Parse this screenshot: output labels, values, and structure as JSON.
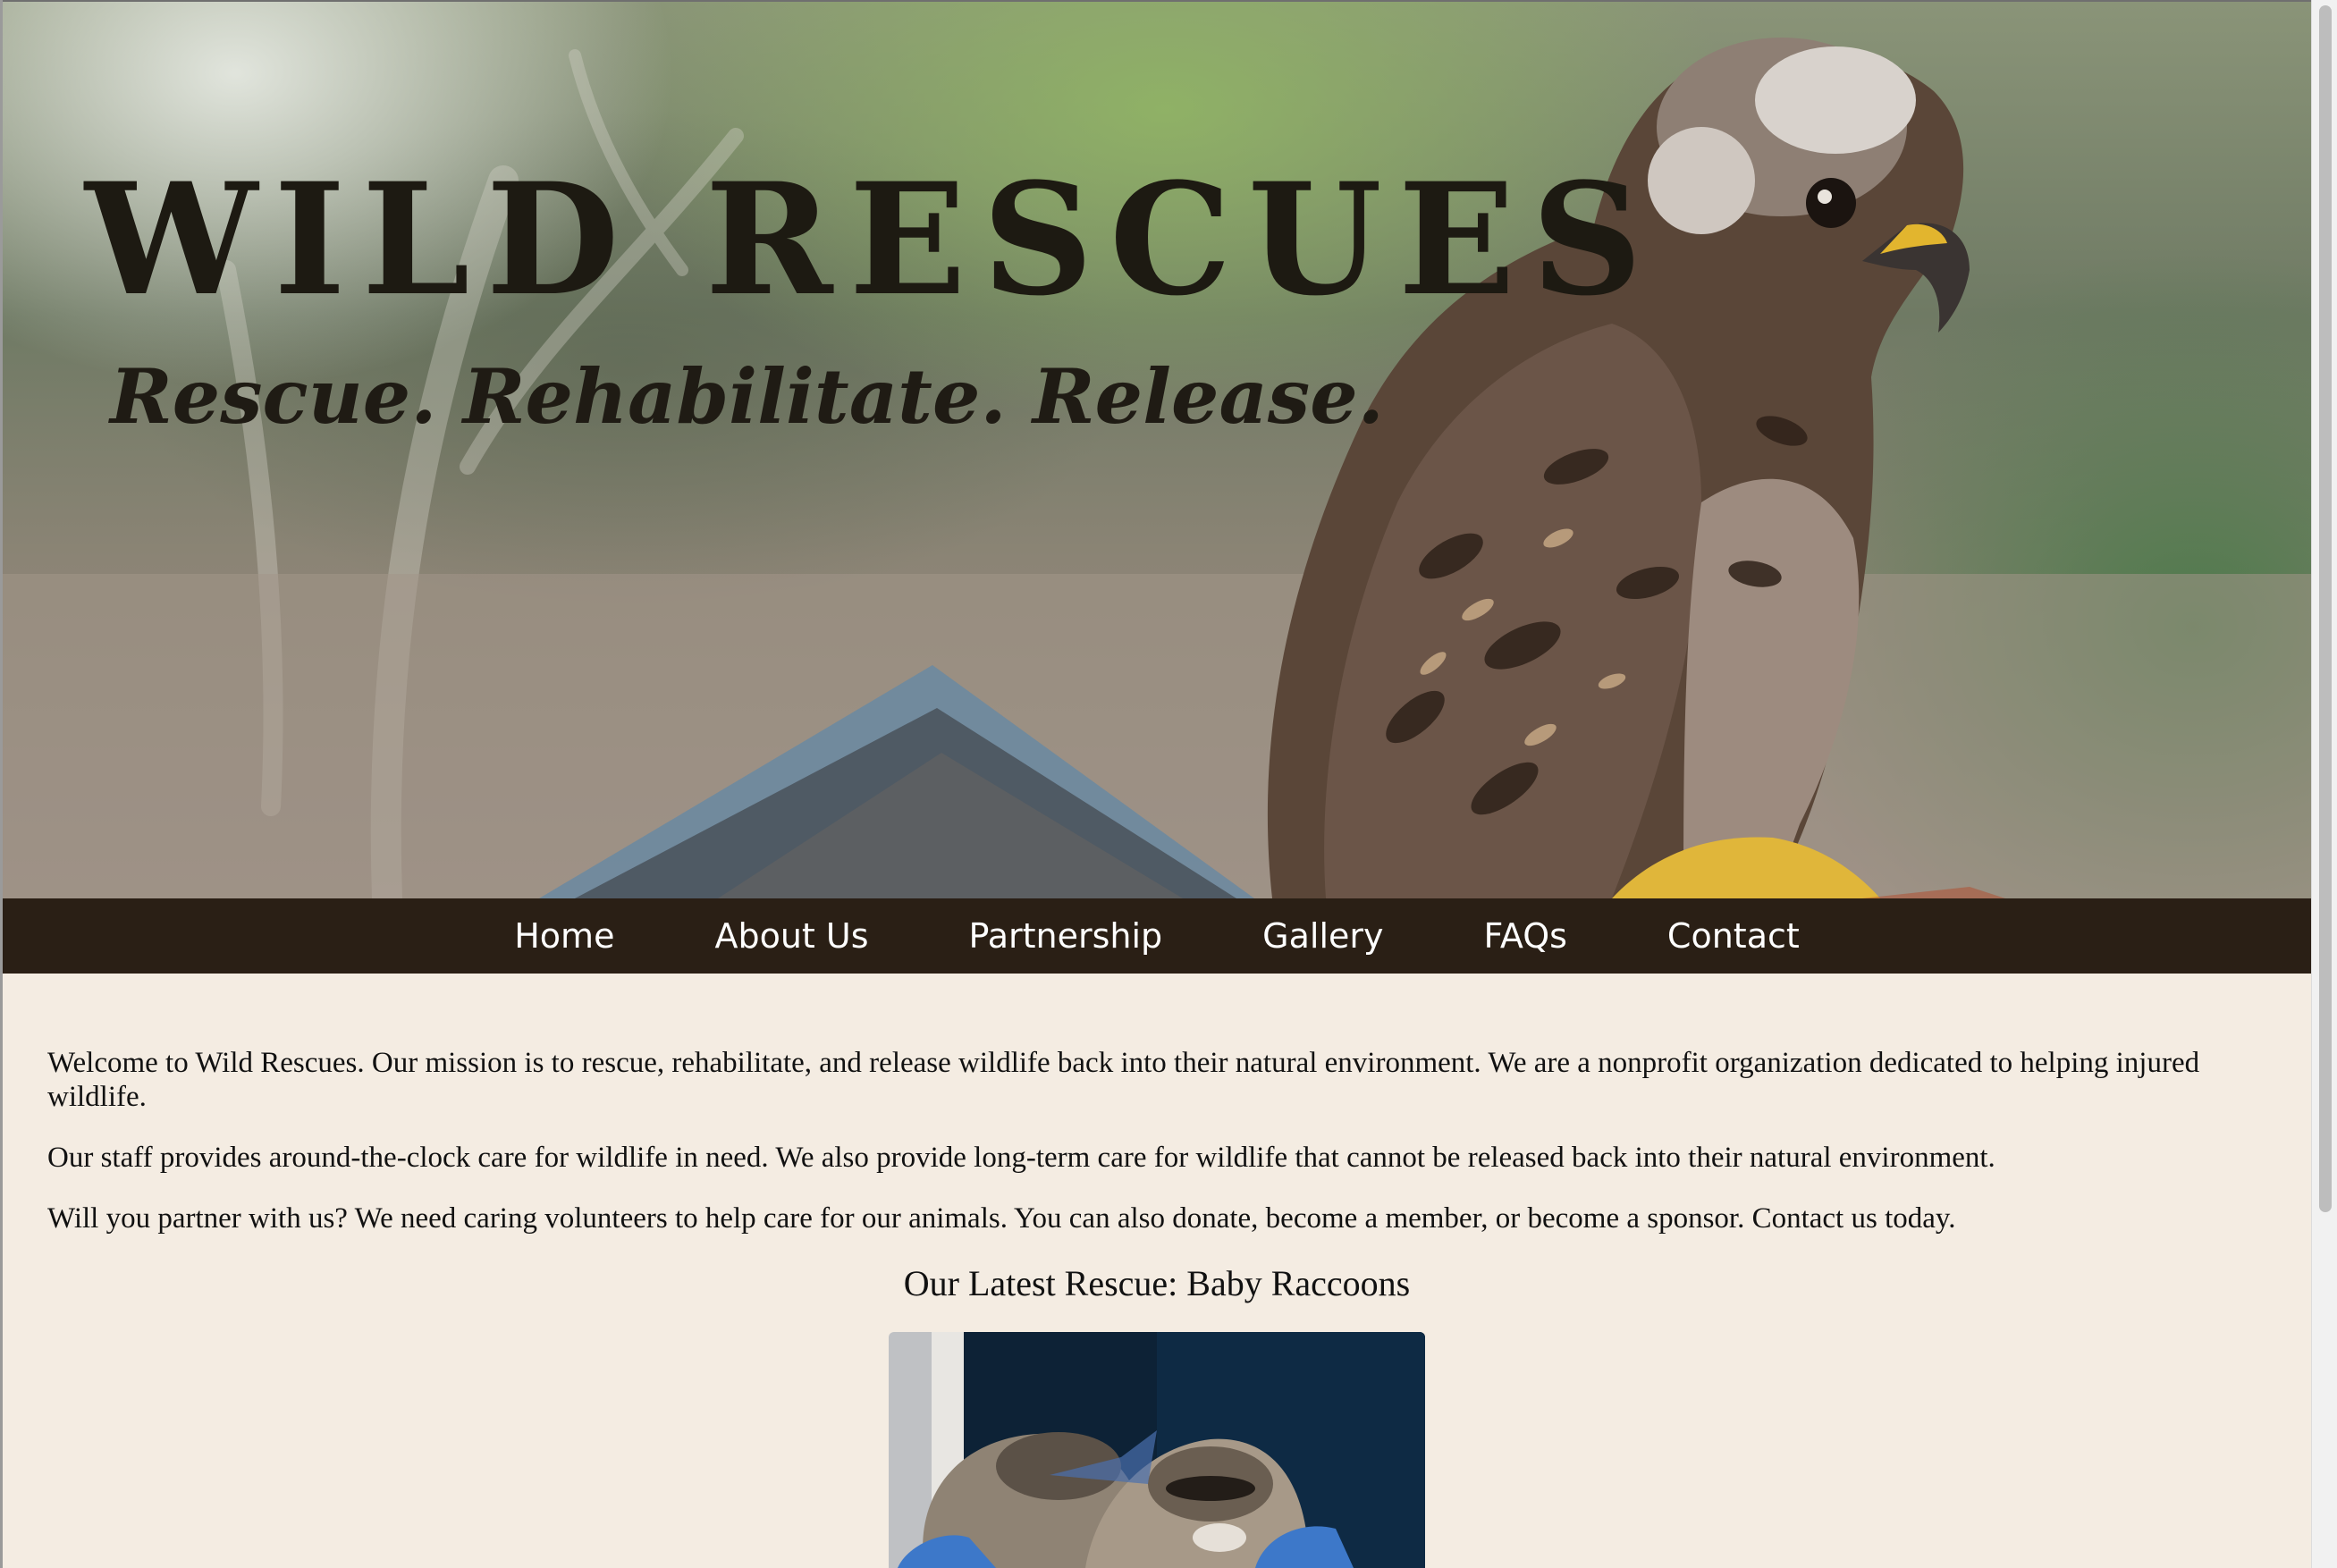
{
  "site": {
    "title": "WILD RESCUES",
    "tagline": "Rescue. Rehabilitate. Release."
  },
  "nav": {
    "items": [
      "Home",
      "About Us",
      "Partnership",
      "Gallery",
      "FAQs",
      "Contact"
    ]
  },
  "main": {
    "paragraphs": [
      "Welcome to Wild Rescues. Our mission is to rescue, rehabilitate, and release wildlife back into their natural environment. We are a nonprofit organization dedicated to helping injured wildlife.",
      "Our staff provides around-the-clock care for wildlife in need. We also provide long-term care for wildlife that cannot be released back into their natural environment.",
      "Will you partner with us? We need caring volunteers to help care for our animals. You can also donate, become a member, or become a sponsor. Contact us today."
    ],
    "latest_heading": "Our Latest Rescue: Baby Raccoons"
  },
  "colors": {
    "nav_background": "#2a1f15",
    "page_background": "#f4ece2",
    "title_text": "#1d1a12"
  }
}
